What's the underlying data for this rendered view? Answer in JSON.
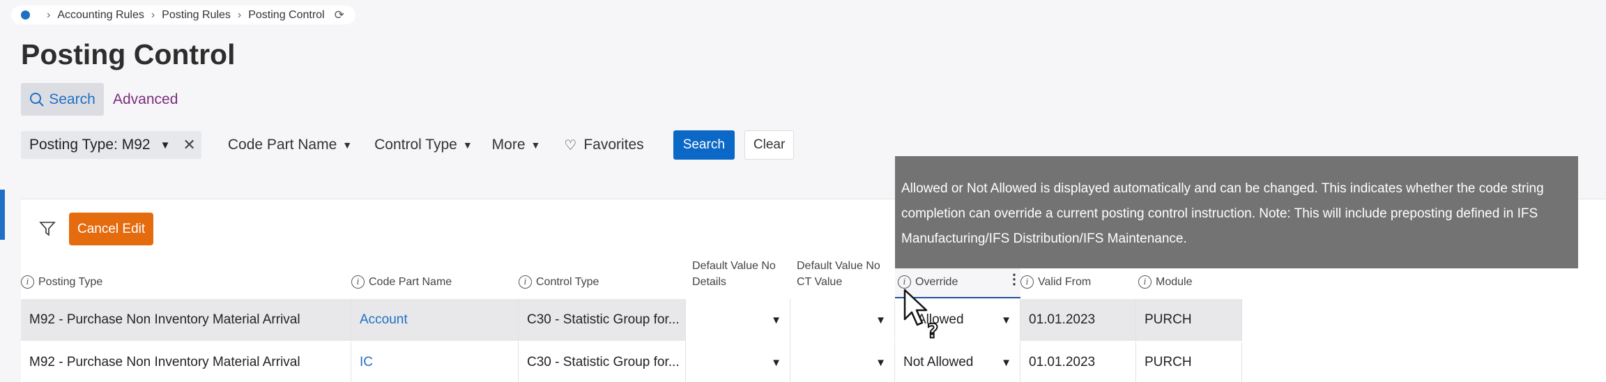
{
  "breadcrumb": {
    "items": [
      "Accounting Rules",
      "Posting Rules",
      "Posting Control"
    ]
  },
  "page": {
    "title": "Posting Control"
  },
  "search_tabs": {
    "search": "Search",
    "advanced": "Advanced"
  },
  "filters": {
    "chip_label": "Posting Type: M92",
    "code_part_name": "Code Part Name",
    "control_type": "Control Type",
    "more": "More",
    "favorites": "Favorites",
    "search_button": "Search",
    "clear_button": "Clear"
  },
  "toolbar": {
    "cancel_edit": "Cancel Edit"
  },
  "columns": {
    "posting_type": "Posting Type",
    "code_part_name": "Code Part Name",
    "control_type": "Control Type",
    "default_value_no_details_1": "Default Value No",
    "default_value_no_details_2": "Details",
    "default_value_no_ct_1": "Default Value No",
    "default_value_no_ct_2": "CT Value",
    "override": "Override",
    "valid_from": "Valid From",
    "module": "Module"
  },
  "rows": [
    {
      "posting_type": "M92 - Purchase Non Inventory Material Arrival",
      "code_part_name": "Account",
      "control_type": "C30 - Statistic Group for...",
      "override": "Allowed",
      "valid_from": "01.01.2023",
      "module": "PURCH"
    },
    {
      "posting_type": "M92 - Purchase Non Inventory Material Arrival",
      "code_part_name": "IC",
      "control_type": "C30 - Statistic Group for...",
      "override": "Not Allowed",
      "valid_from": "01.01.2023",
      "module": "PURCH"
    }
  ],
  "tooltip": {
    "text": "Allowed or Not Allowed is displayed automatically and can be changed. This indicates whether the code string completion can override a current posting control instruction. Note: This will include preposting defined in IFS Manufacturing/IFS Distribution/IFS Maintenance."
  },
  "colors": {
    "accent": "#1f6fc5",
    "search_button": "#0b68c6",
    "cancel_button": "#e46b0e",
    "advanced_link": "#7a2e7c",
    "tooltip_bg": "#737373"
  }
}
